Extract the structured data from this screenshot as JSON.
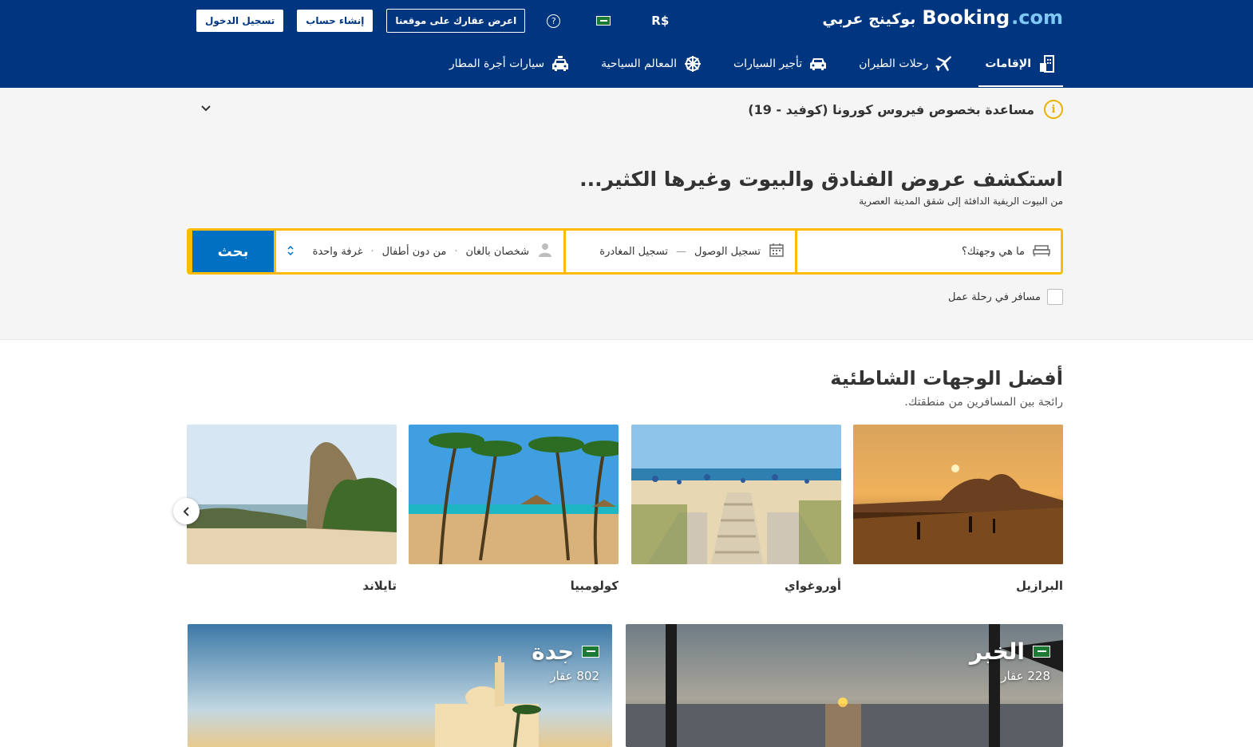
{
  "header": {
    "logo_brand": "Booking",
    "logo_tld": ".com",
    "logo_arabic": "بوكينج عربي",
    "currency": "R$",
    "btn_list_property": "اعرض عقارك على موقعنا",
    "btn_register": "إنشاء حساب",
    "btn_signin": "تسجيل الدخول",
    "help": "?"
  },
  "nav": {
    "items": [
      {
        "label": "الإقامات",
        "icon": "bed-building-icon",
        "active": true
      },
      {
        "label": "رحلات الطيران",
        "icon": "plane-icon"
      },
      {
        "label": "تأجير السيارات",
        "icon": "car-icon"
      },
      {
        "label": "المعالم السياحية",
        "icon": "attraction-icon"
      },
      {
        "label": "سيارات أجرة المطار",
        "icon": "taxi-icon"
      }
    ]
  },
  "covid": {
    "text": "مساعدة بخصوص فيروس كورونا (كوفيد - 19)",
    "icon": "i"
  },
  "hero": {
    "title": "استكشف عروض الفنادق والبيوت وغيرها الكثير...",
    "subtitle": "من البيوت الريفية الدافئة إلى شقق المدينة العصرية"
  },
  "search": {
    "destination_placeholder": "ما هي وجهتك؟",
    "checkin": "تسجيل الوصول",
    "dash": "—",
    "checkout": "تسجيل المغادرة",
    "adults": "شخصان بالغان",
    "children": "من دون أطفال",
    "rooms": "غرفة واحدة",
    "dot": "·",
    "button": "بحث",
    "business": "مسافر في رحلة عمل"
  },
  "beach": {
    "title": "أفضل الوجهات الشاطئية",
    "subtitle": "رائجة بين المسافرين من منطقتك.",
    "cards": [
      {
        "label": "البرازيل"
      },
      {
        "label": "أوروغواي"
      },
      {
        "label": "كولومبيا"
      },
      {
        "label": "تايلاند"
      }
    ]
  },
  "cities": [
    {
      "name": "الخبر",
      "count": "228 عقار"
    },
    {
      "name": "جدة",
      "count": "802 عقار"
    }
  ]
}
